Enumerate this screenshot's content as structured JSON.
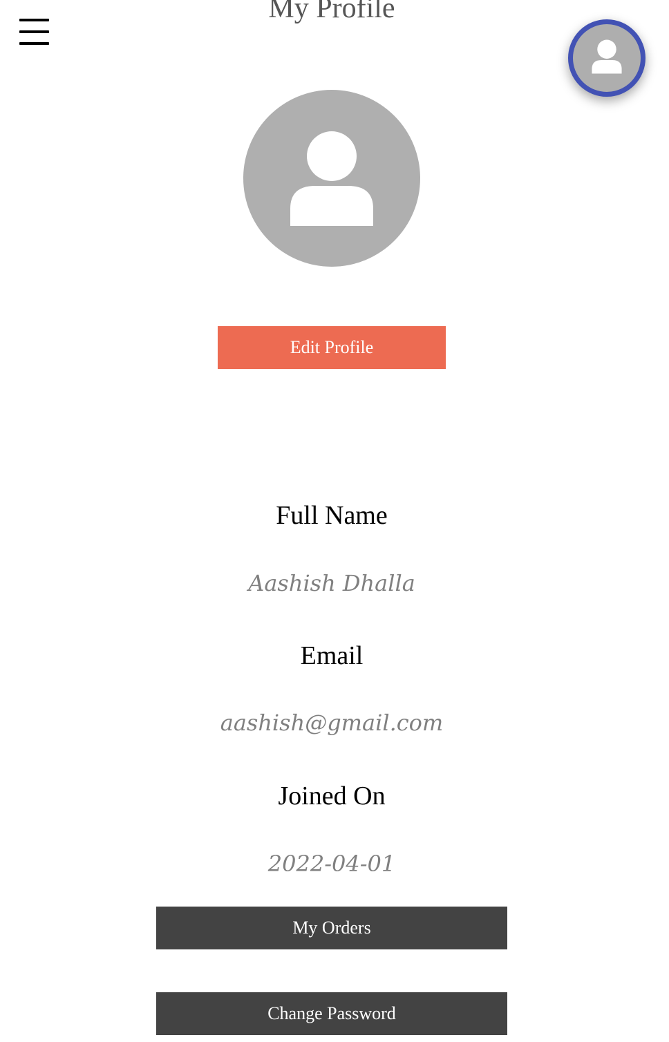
{
  "header": {
    "title": "My Profile",
    "menu_icon": "hamburger-menu-icon",
    "account_icon": "user-avatar-icon"
  },
  "profile": {
    "avatar_icon": "user-avatar-icon",
    "edit_button": "Edit Profile",
    "fields": [
      {
        "label": "Full Name",
        "value": "Aashish Dhalla"
      },
      {
        "label": "Email",
        "value": "aashish@gmail.com"
      },
      {
        "label": "Joined On",
        "value": "2022-04-01"
      }
    ]
  },
  "actions": {
    "orders_button": "My Orders",
    "change_password_button": "Change Password"
  },
  "colors": {
    "edit_button": "#ed6b52",
    "dark_button": "#434343",
    "avatar_ring": "#4252b4",
    "avatar_bg": "#afafaf"
  }
}
